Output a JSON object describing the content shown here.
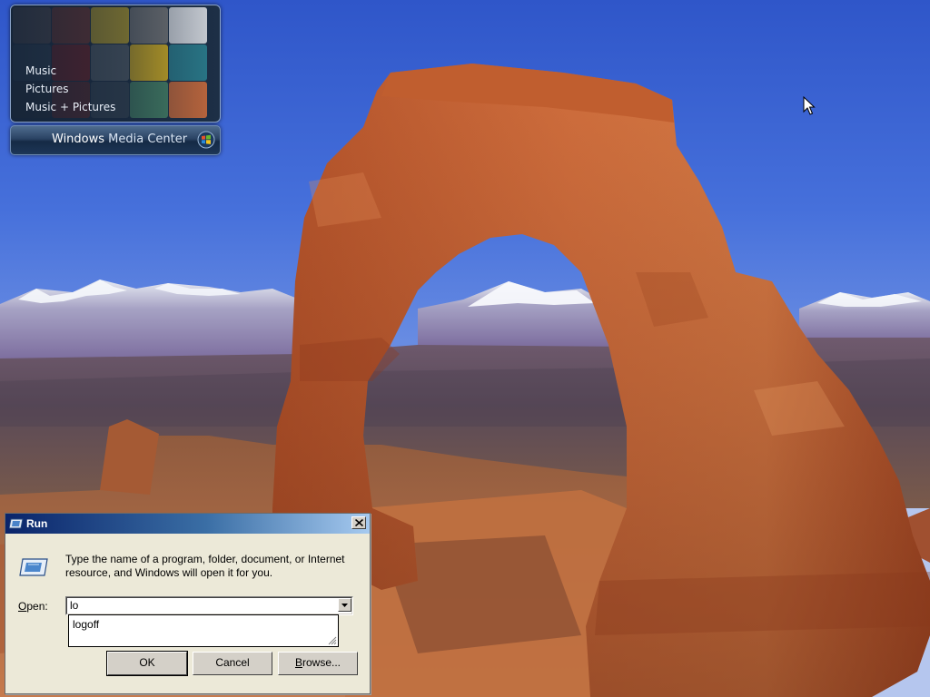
{
  "media_center": {
    "menu": [
      "Music",
      "Pictures",
      "Music + Pictures"
    ],
    "brand_main": "Windows",
    "brand_sub": "Media Center"
  },
  "run_dialog": {
    "title": "Run",
    "prompt": "Type the name of a program, folder, document, or Internet resource, and Windows will open it for you.",
    "open_label_mnemonic": "O",
    "open_label_rest": "pen:",
    "input_value": "lo",
    "suggestions": [
      "logoff"
    ],
    "ok_label": "OK",
    "cancel_label": "Cancel",
    "browse_mnemonic": "B",
    "browse_rest": "rowse..."
  },
  "colors": {
    "title_gradient_start": "#0a246a",
    "title_gradient_end": "#a6caf0",
    "dialog_bg": "#ece9d8",
    "sky": "#3c64d2",
    "rock": "#b8582c"
  },
  "icons": [
    "close-icon",
    "run-icon",
    "chevron-down-icon",
    "windows-orb-icon",
    "mouse-cursor-icon",
    "resize-grip-icon"
  ]
}
